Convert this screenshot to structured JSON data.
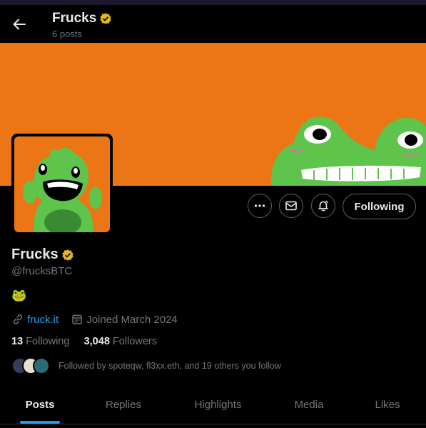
{
  "header": {
    "title": "Frucks",
    "posts_count": "6 posts"
  },
  "profile": {
    "name": "Frucks",
    "handle": "@frucksBTC",
    "bio": "🐸",
    "link": "fruck.it",
    "joined": "Joined March 2024",
    "following_count": "3",
    "following_label": "Following",
    "followers_count": "3,048",
    "followers_label": "Followers",
    "followed_by": "Followed by spoteqw, fl3xx.eth, and 19 others you follow",
    "follow_button": "Following"
  },
  "following_prefix": "1",
  "tabs": [
    "Posts",
    "Replies",
    "Highlights",
    "Media",
    "Likes"
  ],
  "active_tab": "Posts",
  "colors": {
    "accent": "#1d9bf0",
    "banner": "#ec7616",
    "verified_badge": "#e2b719",
    "background": "#000000"
  },
  "icons": [
    "back-arrow-icon",
    "verified-badge-icon",
    "more-icon",
    "mail-icon",
    "notify-bell-icon",
    "link-icon",
    "calendar-icon"
  ]
}
